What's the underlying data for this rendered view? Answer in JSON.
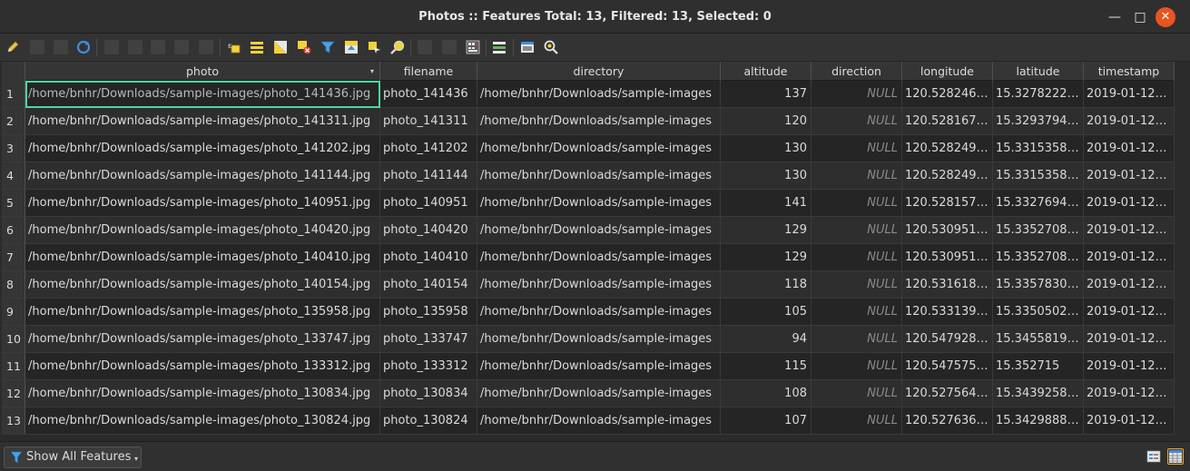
{
  "window": {
    "title": "Photos :: Features Total: 13, Filtered: 13, Selected: 0",
    "minimize_icon": "minimize-icon",
    "maximize_icon": "maximize-icon",
    "close_icon": "close-icon"
  },
  "toolbar": {
    "icons": [
      "toggle-editing-icon",
      "multi-edit-icon",
      "save-edits-icon",
      "reload-icon",
      "add-feature-icon",
      "delete-feature-icon",
      "cut-icon",
      "copy-icon",
      "paste-icon",
      "expression-select-icon",
      "select-all-icon",
      "invert-selection-icon",
      "deselect-all-icon",
      "filter-icon",
      "move-selection-top-icon",
      "pan-to-selected-icon",
      "zoom-to-selected-icon",
      "new-field-icon",
      "delete-field-icon",
      "field-calculator-icon",
      "conditional-formatting-icon",
      "dock-icon",
      "actions-icon"
    ]
  },
  "table": {
    "columns": [
      "photo",
      "filename",
      "directory",
      "altitude",
      "direction",
      "longitude",
      "latitude",
      "timestamp"
    ],
    "sort_column_indicator": "▾",
    "rows": [
      {
        "n": "1",
        "photo": "/home/bnhr/Downloads/sample-images/photo_141436.jpg",
        "filename": "photo_141436",
        "directory": "/home/bnhr/Downloads/sample-images",
        "altitude": "137",
        "direction": "NULL",
        "longitude": "120.528246…",
        "latitude": "15.3278222…",
        "timestamp": "2019-01-12…"
      },
      {
        "n": "2",
        "photo": "/home/bnhr/Downloads/sample-images/photo_141311.jpg",
        "filename": "photo_141311",
        "directory": "/home/bnhr/Downloads/sample-images",
        "altitude": "120",
        "direction": "NULL",
        "longitude": "120.528167…",
        "latitude": "15.3293794…",
        "timestamp": "2019-01-12…"
      },
      {
        "n": "3",
        "photo": "/home/bnhr/Downloads/sample-images/photo_141202.jpg",
        "filename": "photo_141202",
        "directory": "/home/bnhr/Downloads/sample-images",
        "altitude": "130",
        "direction": "NULL",
        "longitude": "120.528249…",
        "latitude": "15.3315358…",
        "timestamp": "2019-01-12…"
      },
      {
        "n": "4",
        "photo": "/home/bnhr/Downloads/sample-images/photo_141144.jpg",
        "filename": "photo_141144",
        "directory": "/home/bnhr/Downloads/sample-images",
        "altitude": "130",
        "direction": "NULL",
        "longitude": "120.528249…",
        "latitude": "15.3315358…",
        "timestamp": "2019-01-12…"
      },
      {
        "n": "5",
        "photo": "/home/bnhr/Downloads/sample-images/photo_140951.jpg",
        "filename": "photo_140951",
        "directory": "/home/bnhr/Downloads/sample-images",
        "altitude": "141",
        "direction": "NULL",
        "longitude": "120.528157…",
        "latitude": "15.3327694…",
        "timestamp": "2019-01-12…"
      },
      {
        "n": "6",
        "photo": "/home/bnhr/Downloads/sample-images/photo_140420.jpg",
        "filename": "photo_140420",
        "directory": "/home/bnhr/Downloads/sample-images",
        "altitude": "129",
        "direction": "NULL",
        "longitude": "120.530951…",
        "latitude": "15.3352708…",
        "timestamp": "2019-01-12…"
      },
      {
        "n": "7",
        "photo": "/home/bnhr/Downloads/sample-images/photo_140410.jpg",
        "filename": "photo_140410",
        "directory": "/home/bnhr/Downloads/sample-images",
        "altitude": "129",
        "direction": "NULL",
        "longitude": "120.530951…",
        "latitude": "15.3352708…",
        "timestamp": "2019-01-12…"
      },
      {
        "n": "8",
        "photo": "/home/bnhr/Downloads/sample-images/photo_140154.jpg",
        "filename": "photo_140154",
        "directory": "/home/bnhr/Downloads/sample-images",
        "altitude": "118",
        "direction": "NULL",
        "longitude": "120.531618…",
        "latitude": "15.3357830…",
        "timestamp": "2019-01-12…"
      },
      {
        "n": "9",
        "photo": "/home/bnhr/Downloads/sample-images/photo_135958.jpg",
        "filename": "photo_135958",
        "directory": "/home/bnhr/Downloads/sample-images",
        "altitude": "105",
        "direction": "NULL",
        "longitude": "120.533139…",
        "latitude": "15.3350502…",
        "timestamp": "2019-01-12…"
      },
      {
        "n": "10",
        "photo": "/home/bnhr/Downloads/sample-images/photo_133747.jpg",
        "filename": "photo_133747",
        "directory": "/home/bnhr/Downloads/sample-images",
        "altitude": "94",
        "direction": "NULL",
        "longitude": "120.547928…",
        "latitude": "15.3455819…",
        "timestamp": "2019-01-12…"
      },
      {
        "n": "11",
        "photo": "/home/bnhr/Downloads/sample-images/photo_133312.jpg",
        "filename": "photo_133312",
        "directory": "/home/bnhr/Downloads/sample-images",
        "altitude": "115",
        "direction": "NULL",
        "longitude": "120.547575…",
        "latitude": "15.352715",
        "timestamp": "2019-01-12…"
      },
      {
        "n": "12",
        "photo": "/home/bnhr/Downloads/sample-images/photo_130834.jpg",
        "filename": "photo_130834",
        "directory": "/home/bnhr/Downloads/sample-images",
        "altitude": "108",
        "direction": "NULL",
        "longitude": "120.527564…",
        "latitude": "15.3439258…",
        "timestamp": "2019-01-12…"
      },
      {
        "n": "13",
        "photo": "/home/bnhr/Downloads/sample-images/photo_130824.jpg",
        "filename": "photo_130824",
        "directory": "/home/bnhr/Downloads/sample-images",
        "altitude": "107",
        "direction": "NULL",
        "longitude": "120.527636…",
        "latitude": "15.3429888…",
        "timestamp": "2019-01-12…"
      }
    ]
  },
  "bottom": {
    "filter_label": "Show All Features",
    "filter_icon": "filter-icon",
    "form_view_icon": "form-view-icon",
    "table_view_icon": "table-view-icon"
  },
  "colors": {
    "selection_outline": "#4cd8a0",
    "close_button": "#e95420",
    "active_view_border": "#e9a23b"
  }
}
